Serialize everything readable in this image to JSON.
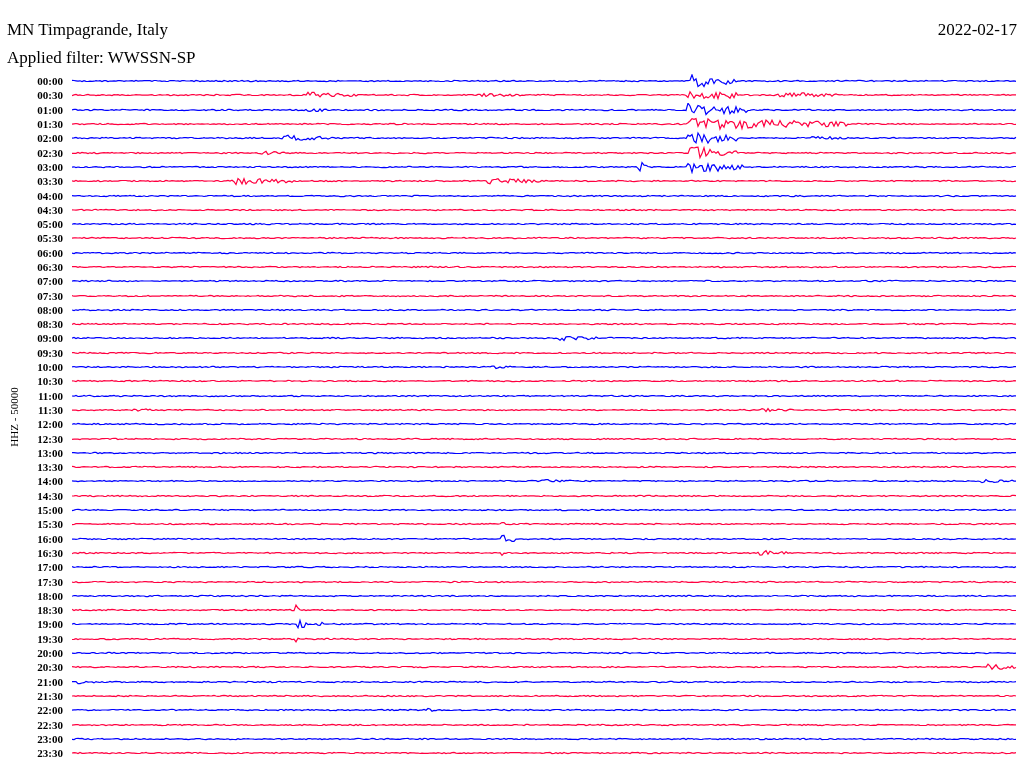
{
  "header": {
    "station": "MN Timpagrande, Italy",
    "date": "2022-02-17",
    "filter": "Applied filter: WWSSN-SP"
  },
  "plot": {
    "axis_label": "HHZ - 50000",
    "rows": [
      {
        "time": "00:00",
        "color": "#0000ff"
      },
      {
        "time": "00:30",
        "color": "#ff0040"
      },
      {
        "time": "01:00",
        "color": "#0000ff"
      },
      {
        "time": "01:30",
        "color": "#ff0040"
      },
      {
        "time": "02:00",
        "color": "#0000ff"
      },
      {
        "time": "02:30",
        "color": "#ff0040"
      },
      {
        "time": "03:00",
        "color": "#0000ff"
      },
      {
        "time": "03:30",
        "color": "#ff0040"
      },
      {
        "time": "04:00",
        "color": "#0000ff"
      },
      {
        "time": "04:30",
        "color": "#ff0040"
      },
      {
        "time": "05:00",
        "color": "#0000ff"
      },
      {
        "time": "05:30",
        "color": "#ff0040"
      },
      {
        "time": "06:00",
        "color": "#0000ff"
      },
      {
        "time": "06:30",
        "color": "#ff0040"
      },
      {
        "time": "07:00",
        "color": "#0000ff"
      },
      {
        "time": "07:30",
        "color": "#ff0040"
      },
      {
        "time": "08:00",
        "color": "#0000ff"
      },
      {
        "time": "08:30",
        "color": "#ff0040"
      },
      {
        "time": "09:00",
        "color": "#0000ff"
      },
      {
        "time": "09:30",
        "color": "#ff0040"
      },
      {
        "time": "10:00",
        "color": "#0000ff"
      },
      {
        "time": "10:30",
        "color": "#ff0040"
      },
      {
        "time": "11:00",
        "color": "#0000ff"
      },
      {
        "time": "11:30",
        "color": "#ff0040"
      },
      {
        "time": "12:00",
        "color": "#0000ff"
      },
      {
        "time": "12:30",
        "color": "#ff0040"
      },
      {
        "time": "13:00",
        "color": "#0000ff"
      },
      {
        "time": "13:30",
        "color": "#ff0040"
      },
      {
        "time": "14:00",
        "color": "#0000ff"
      },
      {
        "time": "14:30",
        "color": "#ff0040"
      },
      {
        "time": "15:00",
        "color": "#0000ff"
      },
      {
        "time": "15:30",
        "color": "#ff0040"
      },
      {
        "time": "16:00",
        "color": "#0000ff"
      },
      {
        "time": "16:30",
        "color": "#ff0040"
      },
      {
        "time": "17:00",
        "color": "#0000ff"
      },
      {
        "time": "17:30",
        "color": "#ff0040"
      },
      {
        "time": "18:00",
        "color": "#0000ff"
      },
      {
        "time": "18:30",
        "color": "#ff0040"
      },
      {
        "time": "19:00",
        "color": "#0000ff"
      },
      {
        "time": "19:30",
        "color": "#ff0040"
      },
      {
        "time": "20:00",
        "color": "#0000ff"
      },
      {
        "time": "20:30",
        "color": "#ff0040"
      },
      {
        "time": "21:00",
        "color": "#0000ff"
      },
      {
        "time": "21:30",
        "color": "#ff0040"
      },
      {
        "time": "22:00",
        "color": "#0000ff"
      },
      {
        "time": "22:30",
        "color": "#ff0040"
      },
      {
        "time": "23:00",
        "color": "#0000ff"
      },
      {
        "time": "23:30",
        "color": "#ff0040"
      }
    ]
  }
}
